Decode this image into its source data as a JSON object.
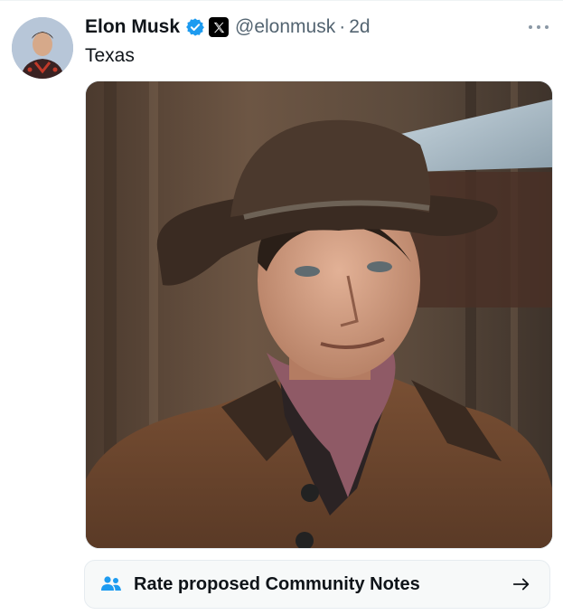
{
  "tweet": {
    "display_name": "Elon Musk",
    "handle": "@elonmusk",
    "separator": "·",
    "time": "2d",
    "text": "Texas",
    "verified": true,
    "affiliate_badge": "x-logo-icon"
  },
  "community_notes": {
    "label": "Rate proposed Community Notes",
    "icon": "people-icon",
    "arrow": "arrow-right-icon"
  },
  "colors": {
    "verified_blue": "#1d9bf0",
    "notes_icon_blue": "#1d9bf0",
    "secondary_text": "#536471"
  }
}
